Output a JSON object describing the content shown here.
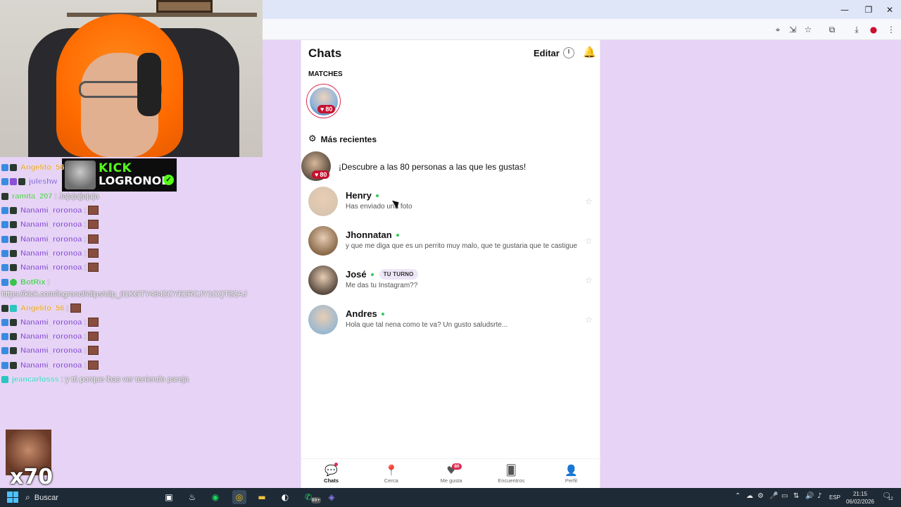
{
  "browser": {
    "window_controls": [
      "—",
      "❐",
      "✕"
    ],
    "toolbar_icons": [
      "location-pin-icon",
      "install-icon",
      "bookmark-star-icon",
      "extensions-icon",
      "download-icon",
      "profile-icon",
      "menu-icon"
    ]
  },
  "stream": {
    "channel_tag": "KICK",
    "channel_name": "LOGRONOL",
    "emote_multiplier": "x70",
    "chat": [
      {
        "user": "Angelito_56",
        "text": "",
        "color": "#e5a335",
        "badges": [
          "b-blue",
          "b-dark"
        ],
        "emote": false
      },
      {
        "user": "juleshw",
        "text": "",
        "color": "#8a6bd8",
        "badges": [
          "b-blue",
          "b-purple",
          "b-dark"
        ],
        "emote": false
      },
      {
        "user": "ramita_207",
        "text": ": Jajajajjajaja",
        "color": "#58c45a",
        "badges": [
          "b-dark"
        ],
        "emote": false
      },
      {
        "user": "Nanami_roronoa",
        "text": ":",
        "color": "#8a4fd6",
        "badges": [
          "b-blue",
          "b-dark"
        ],
        "emote": true
      },
      {
        "user": "Nanami_roronoa",
        "text": ":",
        "color": "#8a4fd6",
        "badges": [
          "b-blue",
          "b-dark"
        ],
        "emote": true
      },
      {
        "user": "Nanami_roronoa",
        "text": ":",
        "color": "#8a4fd6",
        "badges": [
          "b-blue",
          "b-dark"
        ],
        "emote": true
      },
      {
        "user": "Nanami_roronoa",
        "text": ":",
        "color": "#8a4fd6",
        "badges": [
          "b-blue",
          "b-dark"
        ],
        "emote": true
      },
      {
        "user": "Nanami_roronoa",
        "text": ":",
        "color": "#8a4fd6",
        "badges": [
          "b-blue",
          "b-dark"
        ],
        "emote": true
      },
      {
        "user": "BotRix",
        "text": ":",
        "color": "#38c44a",
        "badges": [
          "b-blue",
          "b-green"
        ],
        "emote": false
      },
      {
        "user": "",
        "text": "https://kick.com/logronol/clips/clip_01KGTY434ZCYE2RCJY1CQT8ZAJ",
        "color": "#ffffff",
        "badges": [],
        "emote": false
      },
      {
        "user": "Angelito_56",
        "text": ":",
        "color": "#e5a335",
        "badges": [
          "b-dark",
          "b-teal"
        ],
        "emote": true
      },
      {
        "user": "Nanami_roronoa",
        "text": ":",
        "color": "#8a4fd6",
        "badges": [
          "b-blue",
          "b-dark"
        ],
        "emote": true
      },
      {
        "user": "Nanami_roronoa",
        "text": ":",
        "color": "#8a4fd6",
        "badges": [
          "b-blue",
          "b-dark"
        ],
        "emote": true
      },
      {
        "user": "Nanami_roronoa",
        "text": ":",
        "color": "#8a4fd6",
        "badges": [
          "b-blue",
          "b-dark"
        ],
        "emote": true
      },
      {
        "user": "Nanami_roronoa",
        "text": ":",
        "color": "#8a4fd6",
        "badges": [
          "b-blue",
          "b-dark"
        ],
        "emote": true
      },
      {
        "user": "jeancarlosss",
        "text": ": y tú porque ibas ver teniendo pareja",
        "color": "#3fd0c8",
        "badges": [
          "b-teal"
        ],
        "emote": false
      }
    ]
  },
  "app": {
    "title": "Chats",
    "edit_label": "Editar",
    "matches_label": "MATCHES",
    "match_likes": "80",
    "recent_label": "Más recientes",
    "discover_text": "¡Descubre a las 80 personas a las que les gustas!",
    "discover_likes": "80",
    "chats": [
      {
        "name": "Henry",
        "message": "Has enviado una foto",
        "online": true,
        "turn": "",
        "avatar_color": "#d9c5b0"
      },
      {
        "name": "Jhonnatan",
        "message": "y que me diga que es un perrito muy malo, que te gustaria que te castigue",
        "online": true,
        "turn": "",
        "avatar_color": "#8a6a4a"
      },
      {
        "name": "José",
        "message": "Me das tu Instagram??",
        "online": true,
        "turn": "TU TURNO",
        "avatar_color": "#5a4a40"
      },
      {
        "name": "Andres",
        "message": "Hola que tal nena como te va? Un gusto saludsrte...",
        "online": true,
        "turn": "",
        "avatar_color": "#9ab8d0"
      }
    ],
    "nav": [
      {
        "label": "Chats",
        "icon": "💬",
        "active": true,
        "badge": "dot"
      },
      {
        "label": "Cerca",
        "icon": "📍",
        "active": false,
        "badge": ""
      },
      {
        "label": "Me gusta",
        "icon": "♥",
        "active": false,
        "badge": "80"
      },
      {
        "label": "Encuentros",
        "icon": "🂠",
        "active": false,
        "badge": ""
      },
      {
        "label": "Perfil",
        "icon": "👤",
        "active": false,
        "badge": ""
      }
    ]
  },
  "taskbar": {
    "search_placeholder": "Buscar",
    "language": "ESP",
    "time": "21:15",
    "date": "06/02/2026",
    "notification_count": "12",
    "badge_99": "99+"
  },
  "colors": {
    "page_bg": "#e6d3f5",
    "accent": "#e02952",
    "online": "#34c759",
    "kick_green": "#53fc18"
  }
}
